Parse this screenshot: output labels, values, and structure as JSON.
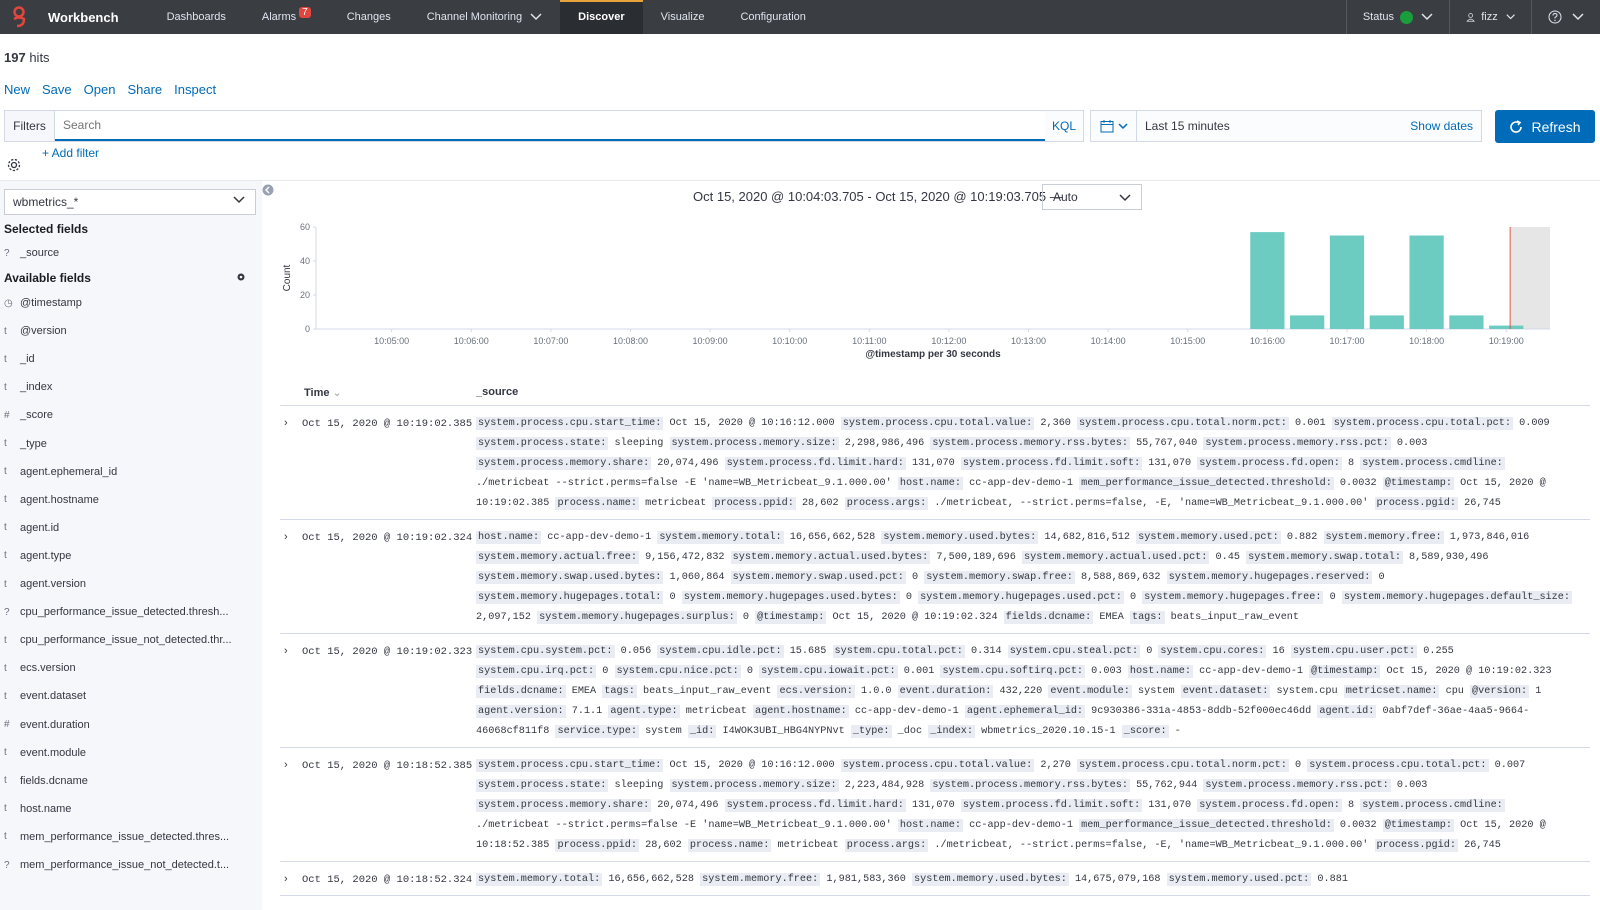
{
  "nav": {
    "brand": "Workbench",
    "items": [
      {
        "label": "Dashboards"
      },
      {
        "label": "Alarms",
        "badge": "7"
      },
      {
        "label": "Changes"
      },
      {
        "label": "Channel Monitoring"
      },
      {
        "label": "Discover"
      },
      {
        "label": "Visualize"
      },
      {
        "label": "Configuration"
      }
    ],
    "status": "Status",
    "user": "fizz",
    "colors": {
      "accent": "#e8a23b",
      "status": "#1a9e3c"
    }
  },
  "hits": {
    "count": "197",
    "label": "hits"
  },
  "menu": {
    "new": "New",
    "save": "Save",
    "open": "Open",
    "share": "Share",
    "inspect": "Inspect"
  },
  "filters": {
    "label": "Filters",
    "placeholder": "Search",
    "kql": "KQL",
    "add": "+ Add filter"
  },
  "time": {
    "quick": "Last 15 minutes",
    "show": "Show dates",
    "refresh": "Refresh",
    "range": "Oct 15, 2020 @ 10:04:03.705 - Oct 15, 2020 @ 10:19:03.705 —",
    "interval": "Auto"
  },
  "sidebar": {
    "index": "wbmetrics_*",
    "selected_title": "Selected fields",
    "selected": [
      {
        "type": "?",
        "name": "_source"
      }
    ],
    "available_title": "Available fields",
    "available": [
      {
        "type": "◷",
        "name": "@timestamp"
      },
      {
        "type": "t",
        "name": "@version"
      },
      {
        "type": "t",
        "name": "_id"
      },
      {
        "type": "t",
        "name": "_index"
      },
      {
        "type": "#",
        "name": "_score"
      },
      {
        "type": "t",
        "name": "_type"
      },
      {
        "type": "t",
        "name": "agent.ephemeral_id"
      },
      {
        "type": "t",
        "name": "agent.hostname"
      },
      {
        "type": "t",
        "name": "agent.id"
      },
      {
        "type": "t",
        "name": "agent.type"
      },
      {
        "type": "t",
        "name": "agent.version"
      },
      {
        "type": "?",
        "name": "cpu_performance_issue_detected.thresh..."
      },
      {
        "type": "t",
        "name": "cpu_performance_issue_not_detected.thr..."
      },
      {
        "type": "t",
        "name": "ecs.version"
      },
      {
        "type": "t",
        "name": "event.dataset"
      },
      {
        "type": "#",
        "name": "event.duration"
      },
      {
        "type": "t",
        "name": "event.module"
      },
      {
        "type": "t",
        "name": "fields.dcname"
      },
      {
        "type": "t",
        "name": "host.name"
      },
      {
        "type": "t",
        "name": "mem_performance_issue_detected.thres..."
      },
      {
        "type": "?",
        "name": "mem_performance_issue_not_detected.t..."
      }
    ]
  },
  "chart_data": {
    "type": "bar",
    "ylabel": "Count",
    "xlabel": "@timestamp per 30 seconds",
    "ylim": [
      0,
      60
    ],
    "yticks": [
      0,
      20,
      40,
      60
    ],
    "xticks": [
      "10:05:00",
      "10:06:00",
      "10:07:00",
      "10:08:00",
      "10:09:00",
      "10:10:00",
      "10:11:00",
      "10:12:00",
      "10:13:00",
      "10:14:00",
      "10:15:00",
      "10:16:00",
      "10:17:00",
      "10:18:00",
      "10:19:00"
    ],
    "bars": [
      {
        "x": "10:16:00",
        "y": 57
      },
      {
        "x": "10:16:30",
        "y": 8
      },
      {
        "x": "10:17:00",
        "y": 55
      },
      {
        "x": "10:17:30",
        "y": 8
      },
      {
        "x": "10:18:00",
        "y": 55
      },
      {
        "x": "10:18:30",
        "y": 8
      },
      {
        "x": "10:19:00",
        "y": 2
      }
    ],
    "color": "#6dccc1"
  },
  "table": {
    "col_time": "Time",
    "col_source": "_source",
    "rows": [
      {
        "time": "Oct 15, 2020 @ 10:19:02.385",
        "fields": [
          [
            "system.process.cpu.start_time:",
            "Oct 15, 2020 @ 10:16:12.000"
          ],
          [
            "system.process.cpu.total.value:",
            "2,360"
          ],
          [
            "system.process.cpu.total.norm.pct:",
            "0.001"
          ],
          [
            "system.process.cpu.total.pct:",
            "0.009"
          ],
          [
            "system.process.state:",
            "sleeping"
          ],
          [
            "system.process.memory.size:",
            "2,298,986,496"
          ],
          [
            "system.process.memory.rss.bytes:",
            "55,767,040"
          ],
          [
            "system.process.memory.rss.pct:",
            "0.003"
          ],
          [
            "system.process.memory.share:",
            "20,074,496"
          ],
          [
            "system.process.fd.limit.hard:",
            "131,070"
          ],
          [
            "system.process.fd.limit.soft:",
            "131,070"
          ],
          [
            "system.process.fd.open:",
            "8"
          ],
          [
            "system.process.cmdline:",
            "./metricbeat --strict.perms=false -E 'name=WB_Metricbeat_9.1.000.00'"
          ],
          [
            "host.name:",
            "cc-app-dev-demo-1"
          ],
          [
            "mem_performance_issue_detected.threshold:",
            "0.0032"
          ],
          [
            "@timestamp:",
            "Oct 15, 2020 @ 10:19:02.385"
          ],
          [
            "process.name:",
            "metricbeat"
          ],
          [
            "process.ppid:",
            "28,602"
          ],
          [
            "process.args:",
            "./metricbeat, --strict.perms=false, -E, 'name=WB_Metricbeat_9.1.000.00'"
          ],
          [
            "process.pgid:",
            "26,745"
          ]
        ]
      },
      {
        "time": "Oct 15, 2020 @ 10:19:02.324",
        "fields": [
          [
            "host.name:",
            "cc-app-dev-demo-1"
          ],
          [
            "system.memory.total:",
            "16,656,662,528"
          ],
          [
            "system.memory.used.bytes:",
            "14,682,816,512"
          ],
          [
            "system.memory.used.pct:",
            "0.882"
          ],
          [
            "system.memory.free:",
            "1,973,846,016"
          ],
          [
            "system.memory.actual.free:",
            "9,156,472,832"
          ],
          [
            "system.memory.actual.used.bytes:",
            "7,500,189,696"
          ],
          [
            "system.memory.actual.used.pct:",
            "0.45"
          ],
          [
            "system.memory.swap.total:",
            "8,589,930,496"
          ],
          [
            "system.memory.swap.used.bytes:",
            "1,060,864"
          ],
          [
            "system.memory.swap.used.pct:",
            "0"
          ],
          [
            "system.memory.swap.free:",
            "8,588,869,632"
          ],
          [
            "system.memory.hugepages.reserved:",
            "0"
          ],
          [
            "system.memory.hugepages.total:",
            "0"
          ],
          [
            "system.memory.hugepages.used.bytes:",
            "0"
          ],
          [
            "system.memory.hugepages.used.pct:",
            "0"
          ],
          [
            "system.memory.hugepages.free:",
            "0"
          ],
          [
            "system.memory.hugepages.default_size:",
            "2,097,152"
          ],
          [
            "system.memory.hugepages.surplus:",
            "0"
          ],
          [
            "@timestamp:",
            "Oct 15, 2020 @ 10:19:02.324"
          ],
          [
            "fields.dcname:",
            "EMEA"
          ],
          [
            "tags:",
            "beats_input_raw_event"
          ]
        ]
      },
      {
        "time": "Oct 15, 2020 @ 10:19:02.323",
        "fields": [
          [
            "system.cpu.system.pct:",
            "0.056"
          ],
          [
            "system.cpu.idle.pct:",
            "15.685"
          ],
          [
            "system.cpu.total.pct:",
            "0.314"
          ],
          [
            "system.cpu.steal.pct:",
            "0"
          ],
          [
            "system.cpu.cores:",
            "16"
          ],
          [
            "system.cpu.user.pct:",
            "0.255"
          ],
          [
            "system.cpu.irq.pct:",
            "0"
          ],
          [
            "system.cpu.nice.pct:",
            "0"
          ],
          [
            "system.cpu.iowait.pct:",
            "0.001"
          ],
          [
            "system.cpu.softirq.pct:",
            "0.003"
          ],
          [
            "host.name:",
            "cc-app-dev-demo-1"
          ],
          [
            "@timestamp:",
            "Oct 15, 2020 @ 10:19:02.323"
          ],
          [
            "fields.dcname:",
            "EMEA"
          ],
          [
            "tags:",
            "beats_input_raw_event"
          ],
          [
            "ecs.version:",
            "1.0.0"
          ],
          [
            "event.duration:",
            "432,220"
          ],
          [
            "event.module:",
            "system"
          ],
          [
            "event.dataset:",
            "system.cpu"
          ],
          [
            "metricset.name:",
            "cpu"
          ],
          [
            "@version:",
            "1"
          ],
          [
            "agent.version:",
            "7.1.1"
          ],
          [
            "agent.type:",
            "metricbeat"
          ],
          [
            "agent.hostname:",
            "cc-app-dev-demo-1"
          ],
          [
            "agent.ephemeral_id:",
            "9c930386-331a-4853-8ddb-52f000ec46dd"
          ],
          [
            "agent.id:",
            "0abf7def-36ae-4aa5-9664-46068cf811f8"
          ],
          [
            "service.type:",
            "system"
          ],
          [
            "_id:",
            "I4WOK3UBI_HBG4NYPNvt"
          ],
          [
            "_type:",
            "_doc"
          ],
          [
            "_index:",
            "wbmetrics_2020.10.15-1"
          ],
          [
            "_score:",
            "-"
          ]
        ]
      },
      {
        "time": "Oct 15, 2020 @ 10:18:52.385",
        "fields": [
          [
            "system.process.cpu.start_time:",
            "Oct 15, 2020 @ 10:16:12.000"
          ],
          [
            "system.process.cpu.total.value:",
            "2,270"
          ],
          [
            "system.process.cpu.total.norm.pct:",
            "0"
          ],
          [
            "system.process.cpu.total.pct:",
            "0.007"
          ],
          [
            "system.process.state:",
            "sleeping"
          ],
          [
            "system.process.memory.size:",
            "2,223,484,928"
          ],
          [
            "system.process.memory.rss.bytes:",
            "55,762,944"
          ],
          [
            "system.process.memory.rss.pct:",
            "0.003"
          ],
          [
            "system.process.memory.share:",
            "20,074,496"
          ],
          [
            "system.process.fd.limit.hard:",
            "131,070"
          ],
          [
            "system.process.fd.limit.soft:",
            "131,070"
          ],
          [
            "system.process.fd.open:",
            "8"
          ],
          [
            "system.process.cmdline:",
            "./metricbeat --strict.perms=false -E 'name=WB_Metricbeat_9.1.000.00'"
          ],
          [
            "host.name:",
            "cc-app-dev-demo-1"
          ],
          [
            "mem_performance_issue_detected.threshold:",
            "0.0032"
          ],
          [
            "@timestamp:",
            "Oct 15, 2020 @ 10:18:52.385"
          ],
          [
            "process.ppid:",
            "28,602"
          ],
          [
            "process.name:",
            "metricbeat"
          ],
          [
            "process.args:",
            "./metricbeat, --strict.perms=false, -E, 'name=WB_Metricbeat_9.1.000.00'"
          ],
          [
            "process.pgid:",
            "26,745"
          ]
        ]
      },
      {
        "time": "Oct 15, 2020 @ 10:18:52.324",
        "fields": [
          [
            "system.memory.total:",
            "16,656,662,528"
          ],
          [
            "system.memory.free:",
            "1,981,583,360"
          ],
          [
            "system.memory.used.bytes:",
            "14,675,079,168"
          ],
          [
            "system.memory.used.pct:",
            "0.881"
          ]
        ]
      }
    ]
  }
}
